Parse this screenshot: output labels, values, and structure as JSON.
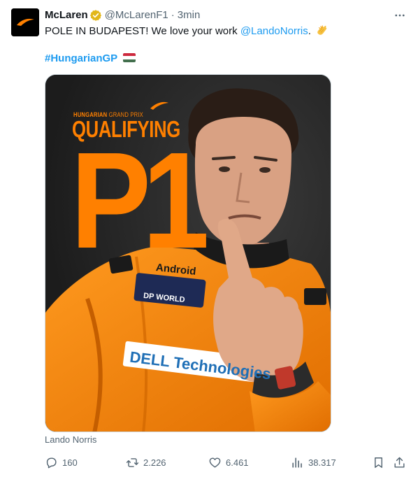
{
  "tweet": {
    "author_name": "McLaren",
    "author_handle": "@McLarenF1",
    "separator": "·",
    "timestamp": "3min",
    "text_part1": "POLE IN BUDAPEST! We love your work ",
    "mention": "@LandoNorris",
    "text_part2": ".",
    "hashtag": "#HungarianGP"
  },
  "media": {
    "poster_gp_bold": "HUNGARIAN",
    "poster_gp_light": "GRAND PRIX",
    "poster_title": "QUALIFYING",
    "poster_position": "P1",
    "sponsor_android": "Android",
    "sponsor_dpworld": "DP WORLD",
    "sponsor_dell": "DELL Technologies",
    "caption": "Lando Norris"
  },
  "actions": {
    "replies": "160",
    "reposts": "2.226",
    "likes": "6.461",
    "views": "38.317"
  },
  "icons": {
    "verified": "verified-badge-icon",
    "more": "more-icon",
    "reply": "reply-icon",
    "repost": "repost-icon",
    "like": "heart-icon",
    "views": "views-icon",
    "bookmark": "bookmark-icon",
    "share": "share-icon",
    "clap": "clapping-hands-emoji",
    "flag": "hungary-flag-emoji"
  },
  "colors": {
    "accent": "#1d9bf0",
    "mclaren_orange": "#ff8000",
    "muted": "#536471",
    "verified_gold": "#e2b719"
  }
}
